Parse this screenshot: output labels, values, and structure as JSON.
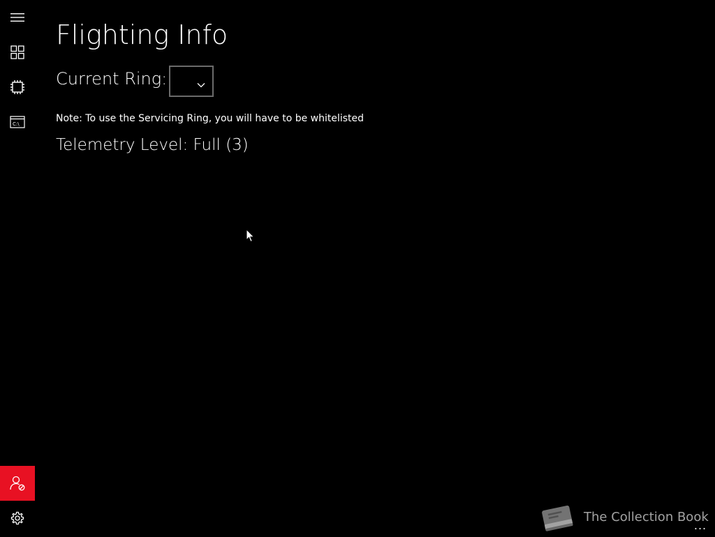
{
  "nav": {
    "items": [
      {
        "icon": "hamburger-menu-icon"
      },
      {
        "icon": "dashboard-tiles-icon"
      },
      {
        "icon": "processor-chip-icon"
      },
      {
        "icon": "command-prompt-icon"
      }
    ],
    "bottom": [
      {
        "icon": "user-block-icon",
        "active": true
      },
      {
        "icon": "gear-icon"
      }
    ],
    "accent_color": "#e81123"
  },
  "page": {
    "title": "Flighting Info",
    "ring_label": "Current Ring:",
    "ring_value": "",
    "note": "Note: To use the Servicing Ring, you will have to be whitelisted",
    "telemetry": "Telemetry Level: Full (3)"
  },
  "watermark": {
    "text": "The Collection Book",
    "icon": "book-icon"
  },
  "more_button": "..."
}
